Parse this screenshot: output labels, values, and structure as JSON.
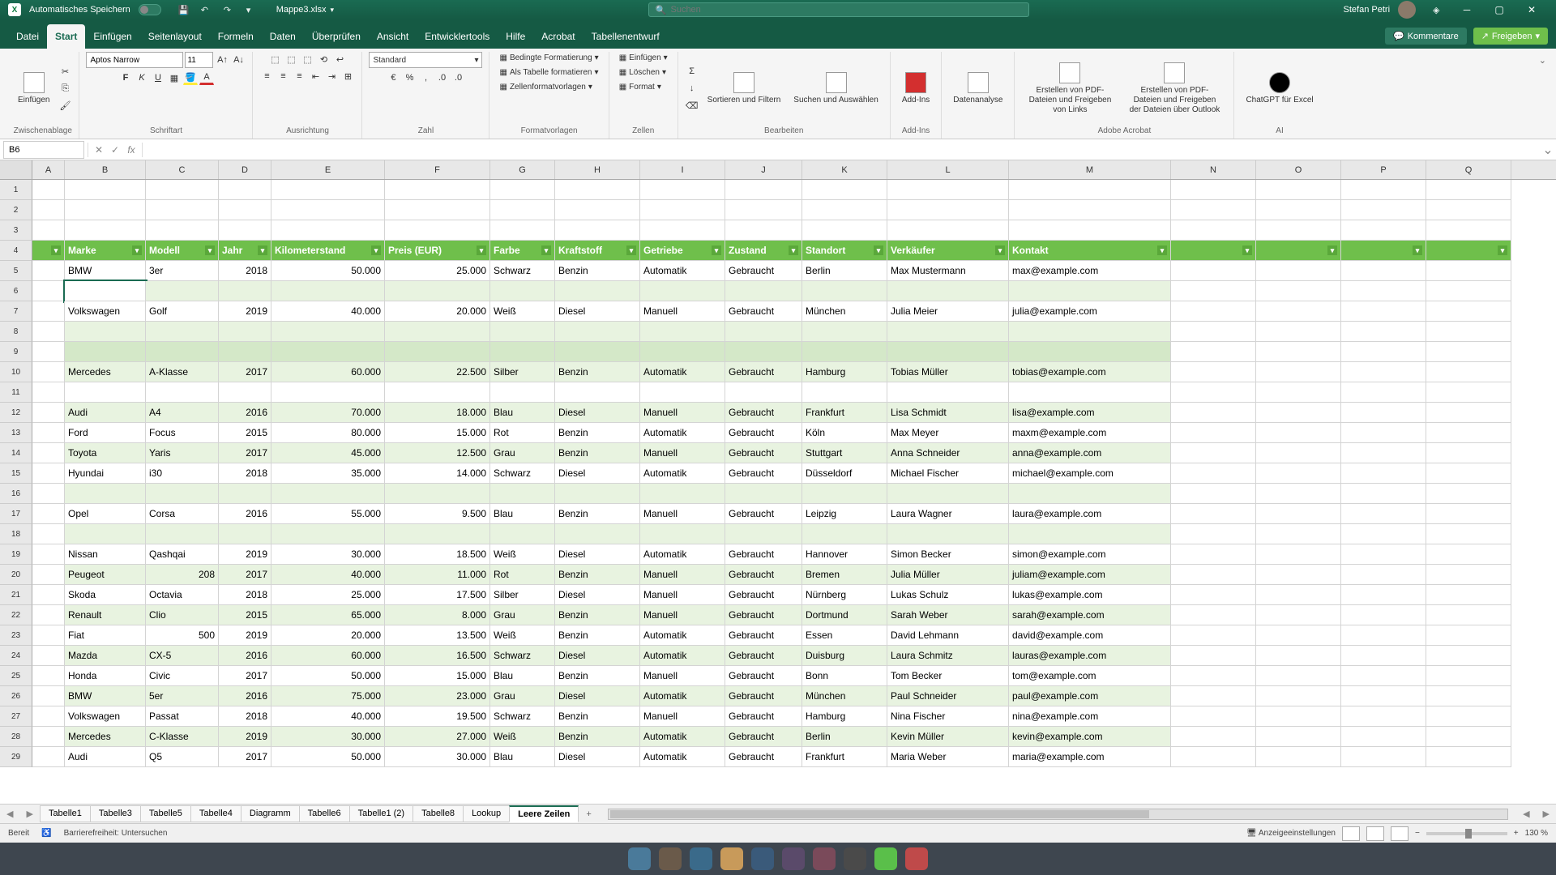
{
  "titlebar": {
    "autosave": "Automatisches Speichern",
    "filename": "Mappe3.xlsx",
    "search_placeholder": "Suchen",
    "user": "Stefan Petri"
  },
  "tabs": {
    "items": [
      "Datei",
      "Start",
      "Einfügen",
      "Seitenlayout",
      "Formeln",
      "Daten",
      "Überprüfen",
      "Ansicht",
      "Entwicklertools",
      "Hilfe",
      "Acrobat",
      "Tabellenentwurf"
    ],
    "active": 1,
    "comments": "Kommentare",
    "share": "Freigeben"
  },
  "ribbon": {
    "clipboard": {
      "title": "Zwischenablage",
      "paste": "Einfügen"
    },
    "font": {
      "title": "Schriftart",
      "name": "Aptos Narrow",
      "size": "11"
    },
    "align": {
      "title": "Ausrichtung"
    },
    "number": {
      "title": "Zahl",
      "format": "Standard"
    },
    "styles": {
      "title": "Formatvorlagen",
      "cond": "Bedingte Formatierung",
      "table": "Als Tabelle formatieren",
      "cell": "Zellenformatvorlagen"
    },
    "cells": {
      "title": "Zellen",
      "insert": "Einfügen",
      "delete": "Löschen",
      "format": "Format"
    },
    "edit": {
      "title": "Bearbeiten",
      "sort": "Sortieren und Filtern",
      "find": "Suchen und Auswählen"
    },
    "addins": {
      "title": "Add-Ins",
      "addins": "Add-Ins"
    },
    "analyze": {
      "label": "Datenanalyse"
    },
    "acrobat": {
      "title": "Adobe Acrobat",
      "pdf1": "Erstellen von PDF-Dateien und Freigeben von Links",
      "pdf2": "Erstellen von PDF-Dateien und Freigeben der Dateien über Outlook"
    },
    "ai": {
      "title": "AI",
      "gpt": "ChatGPT für Excel"
    }
  },
  "fbar": {
    "cell": "B6"
  },
  "columns": [
    "A",
    "B",
    "C",
    "D",
    "E",
    "F",
    "G",
    "H",
    "I",
    "J",
    "K",
    "L",
    "M",
    "N",
    "O",
    "P",
    "Q"
  ],
  "headers": [
    "Marke",
    "Modell",
    "Jahr",
    "Kilometerstand",
    "Preis (EUR)",
    "Farbe",
    "Kraftstoff",
    "Getriebe",
    "Zustand",
    "Standort",
    "Verkäufer",
    "Kontakt"
  ],
  "rows": [
    {
      "n": 5,
      "t": "odd",
      "d": [
        "BMW",
        "3er",
        "2018",
        "50.000",
        "25.000",
        "Schwarz",
        "Benzin",
        "Automatik",
        "Gebraucht",
        "Berlin",
        "Max Mustermann",
        "max@example.com"
      ]
    },
    {
      "n": 6,
      "t": "even",
      "d": [
        "",
        "",
        "",
        "",
        "",
        "",
        "",
        "",
        "",
        "",
        "",
        ""
      ],
      "sel": true
    },
    {
      "n": 7,
      "t": "odd",
      "d": [
        "Volkswagen",
        "Golf",
        "2019",
        "40.000",
        "20.000",
        "Weiß",
        "Diesel",
        "Manuell",
        "Gebraucht",
        "München",
        "Julia Meier",
        "julia@example.com"
      ]
    },
    {
      "n": 8,
      "t": "even",
      "d": [
        "",
        "",
        "",
        "",
        "",
        "",
        "",
        "",
        "",
        "",
        "",
        ""
      ]
    },
    {
      "n": 9,
      "t": "empty",
      "d": [
        "",
        "",
        "",
        "",
        "",
        "",
        "",
        "",
        "",
        "",
        "",
        ""
      ]
    },
    {
      "n": 10,
      "t": "even",
      "d": [
        "Mercedes",
        "A-Klasse",
        "2017",
        "60.000",
        "22.500",
        "Silber",
        "Benzin",
        "Automatik",
        "Gebraucht",
        "Hamburg",
        "Tobias Müller",
        "tobias@example.com"
      ]
    },
    {
      "n": 11,
      "t": "odd",
      "d": [
        "",
        "",
        "",
        "",
        "",
        "",
        "",
        "",
        "",
        "",
        "",
        ""
      ]
    },
    {
      "n": 12,
      "t": "even",
      "d": [
        "Audi",
        "A4",
        "2016",
        "70.000",
        "18.000",
        "Blau",
        "Diesel",
        "Manuell",
        "Gebraucht",
        "Frankfurt",
        "Lisa Schmidt",
        "lisa@example.com"
      ]
    },
    {
      "n": 13,
      "t": "odd",
      "d": [
        "Ford",
        "Focus",
        "2015",
        "80.000",
        "15.000",
        "Rot",
        "Benzin",
        "Automatik",
        "Gebraucht",
        "Köln",
        "Max Meyer",
        "maxm@example.com"
      ]
    },
    {
      "n": 14,
      "t": "even",
      "d": [
        "Toyota",
        "Yaris",
        "2017",
        "45.000",
        "12.500",
        "Grau",
        "Benzin",
        "Manuell",
        "Gebraucht",
        "Stuttgart",
        "Anna Schneider",
        "anna@example.com"
      ]
    },
    {
      "n": 15,
      "t": "odd",
      "d": [
        "Hyundai",
        "i30",
        "2018",
        "35.000",
        "14.000",
        "Schwarz",
        "Diesel",
        "Automatik",
        "Gebraucht",
        "Düsseldorf",
        "Michael Fischer",
        "michael@example.com"
      ]
    },
    {
      "n": 16,
      "t": "even",
      "d": [
        "",
        "",
        "",
        "",
        "",
        "",
        "",
        "",
        "",
        "",
        "",
        ""
      ]
    },
    {
      "n": 17,
      "t": "odd",
      "d": [
        "Opel",
        "Corsa",
        "2016",
        "55.000",
        "9.500",
        "Blau",
        "Benzin",
        "Manuell",
        "Gebraucht",
        "Leipzig",
        "Laura Wagner",
        "laura@example.com"
      ]
    },
    {
      "n": 18,
      "t": "even",
      "d": [
        "",
        "",
        "",
        "",
        "",
        "",
        "",
        "",
        "",
        "",
        "",
        ""
      ]
    },
    {
      "n": 19,
      "t": "odd",
      "d": [
        "Nissan",
        "Qashqai",
        "2019",
        "30.000",
        "18.500",
        "Weiß",
        "Diesel",
        "Automatik",
        "Gebraucht",
        "Hannover",
        "Simon Becker",
        "simon@example.com"
      ]
    },
    {
      "n": 20,
      "t": "even",
      "d": [
        "Peugeot",
        "208",
        "2017",
        "40.000",
        "11.000",
        "Rot",
        "Benzin",
        "Manuell",
        "Gebraucht",
        "Bremen",
        "Julia Müller",
        "juliam@example.com"
      ]
    },
    {
      "n": 21,
      "t": "odd",
      "d": [
        "Skoda",
        "Octavia",
        "2018",
        "25.000",
        "17.500",
        "Silber",
        "Diesel",
        "Manuell",
        "Gebraucht",
        "Nürnberg",
        "Lukas Schulz",
        "lukas@example.com"
      ]
    },
    {
      "n": 22,
      "t": "even",
      "d": [
        "Renault",
        "Clio",
        "2015",
        "65.000",
        "8.000",
        "Grau",
        "Benzin",
        "Manuell",
        "Gebraucht",
        "Dortmund",
        "Sarah Weber",
        "sarah@example.com"
      ]
    },
    {
      "n": 23,
      "t": "odd",
      "d": [
        "Fiat",
        "500",
        "2019",
        "20.000",
        "13.500",
        "Weiß",
        "Benzin",
        "Automatik",
        "Gebraucht",
        "Essen",
        "David Lehmann",
        "david@example.com"
      ]
    },
    {
      "n": 24,
      "t": "even",
      "d": [
        "Mazda",
        "CX-5",
        "2016",
        "60.000",
        "16.500",
        "Schwarz",
        "Diesel",
        "Automatik",
        "Gebraucht",
        "Duisburg",
        "Laura Schmitz",
        "lauras@example.com"
      ]
    },
    {
      "n": 25,
      "t": "odd",
      "d": [
        "Honda",
        "Civic",
        "2017",
        "50.000",
        "15.000",
        "Blau",
        "Benzin",
        "Manuell",
        "Gebraucht",
        "Bonn",
        "Tom Becker",
        "tom@example.com"
      ]
    },
    {
      "n": 26,
      "t": "even",
      "d": [
        "BMW",
        "5er",
        "2016",
        "75.000",
        "23.000",
        "Grau",
        "Diesel",
        "Automatik",
        "Gebraucht",
        "München",
        "Paul Schneider",
        "paul@example.com"
      ]
    },
    {
      "n": 27,
      "t": "odd",
      "d": [
        "Volkswagen",
        "Passat",
        "2018",
        "40.000",
        "19.500",
        "Schwarz",
        "Benzin",
        "Manuell",
        "Gebraucht",
        "Hamburg",
        "Nina Fischer",
        "nina@example.com"
      ]
    },
    {
      "n": 28,
      "t": "even",
      "d": [
        "Mercedes",
        "C-Klasse",
        "2019",
        "30.000",
        "27.000",
        "Weiß",
        "Benzin",
        "Automatik",
        "Gebraucht",
        "Berlin",
        "Kevin Müller",
        "kevin@example.com"
      ]
    },
    {
      "n": 29,
      "t": "odd",
      "d": [
        "Audi",
        "Q5",
        "2017",
        "50.000",
        "30.000",
        "Blau",
        "Diesel",
        "Automatik",
        "Gebraucht",
        "Frankfurt",
        "Maria Weber",
        "maria@example.com"
      ]
    }
  ],
  "sheets": {
    "items": [
      "Tabelle1",
      "Tabelle3",
      "Tabelle5",
      "Tabelle4",
      "Diagramm",
      "Tabelle6",
      "Tabelle1 (2)",
      "Tabelle8",
      "Lookup",
      "Leere Zeilen"
    ],
    "active": 9
  },
  "status": {
    "ready": "Bereit",
    "access": "Barrierefreiheit: Untersuchen",
    "display": "Anzeigeeinstellungen",
    "zoom": "130 %"
  }
}
